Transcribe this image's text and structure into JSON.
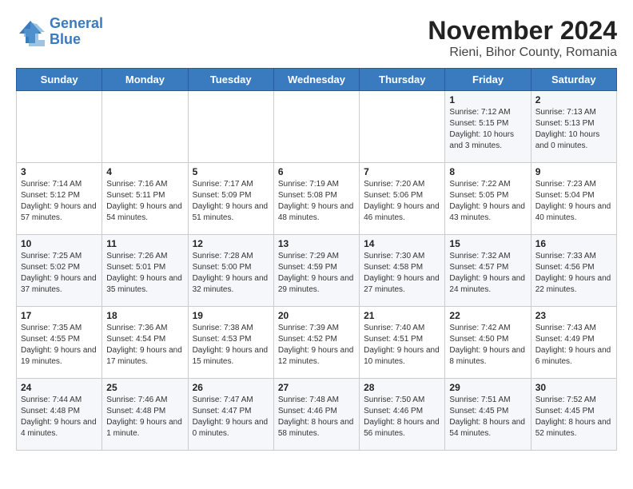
{
  "header": {
    "logo_line1": "General",
    "logo_line2": "Blue",
    "title": "November 2024",
    "subtitle": "Rieni, Bihor County, Romania"
  },
  "weekdays": [
    "Sunday",
    "Monday",
    "Tuesday",
    "Wednesday",
    "Thursday",
    "Friday",
    "Saturday"
  ],
  "weeks": [
    [
      {
        "day": "",
        "info": ""
      },
      {
        "day": "",
        "info": ""
      },
      {
        "day": "",
        "info": ""
      },
      {
        "day": "",
        "info": ""
      },
      {
        "day": "",
        "info": ""
      },
      {
        "day": "1",
        "info": "Sunrise: 7:12 AM\nSunset: 5:15 PM\nDaylight: 10 hours\nand 3 minutes."
      },
      {
        "day": "2",
        "info": "Sunrise: 7:13 AM\nSunset: 5:13 PM\nDaylight: 10 hours\nand 0 minutes."
      }
    ],
    [
      {
        "day": "3",
        "info": "Sunrise: 7:14 AM\nSunset: 5:12 PM\nDaylight: 9 hours\nand 57 minutes."
      },
      {
        "day": "4",
        "info": "Sunrise: 7:16 AM\nSunset: 5:11 PM\nDaylight: 9 hours\nand 54 minutes."
      },
      {
        "day": "5",
        "info": "Sunrise: 7:17 AM\nSunset: 5:09 PM\nDaylight: 9 hours\nand 51 minutes."
      },
      {
        "day": "6",
        "info": "Sunrise: 7:19 AM\nSunset: 5:08 PM\nDaylight: 9 hours\nand 48 minutes."
      },
      {
        "day": "7",
        "info": "Sunrise: 7:20 AM\nSunset: 5:06 PM\nDaylight: 9 hours\nand 46 minutes."
      },
      {
        "day": "8",
        "info": "Sunrise: 7:22 AM\nSunset: 5:05 PM\nDaylight: 9 hours\nand 43 minutes."
      },
      {
        "day": "9",
        "info": "Sunrise: 7:23 AM\nSunset: 5:04 PM\nDaylight: 9 hours\nand 40 minutes."
      }
    ],
    [
      {
        "day": "10",
        "info": "Sunrise: 7:25 AM\nSunset: 5:02 PM\nDaylight: 9 hours\nand 37 minutes."
      },
      {
        "day": "11",
        "info": "Sunrise: 7:26 AM\nSunset: 5:01 PM\nDaylight: 9 hours\nand 35 minutes."
      },
      {
        "day": "12",
        "info": "Sunrise: 7:28 AM\nSunset: 5:00 PM\nDaylight: 9 hours\nand 32 minutes."
      },
      {
        "day": "13",
        "info": "Sunrise: 7:29 AM\nSunset: 4:59 PM\nDaylight: 9 hours\nand 29 minutes."
      },
      {
        "day": "14",
        "info": "Sunrise: 7:30 AM\nSunset: 4:58 PM\nDaylight: 9 hours\nand 27 minutes."
      },
      {
        "day": "15",
        "info": "Sunrise: 7:32 AM\nSunset: 4:57 PM\nDaylight: 9 hours\nand 24 minutes."
      },
      {
        "day": "16",
        "info": "Sunrise: 7:33 AM\nSunset: 4:56 PM\nDaylight: 9 hours\nand 22 minutes."
      }
    ],
    [
      {
        "day": "17",
        "info": "Sunrise: 7:35 AM\nSunset: 4:55 PM\nDaylight: 9 hours\nand 19 minutes."
      },
      {
        "day": "18",
        "info": "Sunrise: 7:36 AM\nSunset: 4:54 PM\nDaylight: 9 hours\nand 17 minutes."
      },
      {
        "day": "19",
        "info": "Sunrise: 7:38 AM\nSunset: 4:53 PM\nDaylight: 9 hours\nand 15 minutes."
      },
      {
        "day": "20",
        "info": "Sunrise: 7:39 AM\nSunset: 4:52 PM\nDaylight: 9 hours\nand 12 minutes."
      },
      {
        "day": "21",
        "info": "Sunrise: 7:40 AM\nSunset: 4:51 PM\nDaylight: 9 hours\nand 10 minutes."
      },
      {
        "day": "22",
        "info": "Sunrise: 7:42 AM\nSunset: 4:50 PM\nDaylight: 9 hours\nand 8 minutes."
      },
      {
        "day": "23",
        "info": "Sunrise: 7:43 AM\nSunset: 4:49 PM\nDaylight: 9 hours\nand 6 minutes."
      }
    ],
    [
      {
        "day": "24",
        "info": "Sunrise: 7:44 AM\nSunset: 4:48 PM\nDaylight: 9 hours\nand 4 minutes."
      },
      {
        "day": "25",
        "info": "Sunrise: 7:46 AM\nSunset: 4:48 PM\nDaylight: 9 hours\nand 1 minute."
      },
      {
        "day": "26",
        "info": "Sunrise: 7:47 AM\nSunset: 4:47 PM\nDaylight: 9 hours\nand 0 minutes."
      },
      {
        "day": "27",
        "info": "Sunrise: 7:48 AM\nSunset: 4:46 PM\nDaylight: 8 hours\nand 58 minutes."
      },
      {
        "day": "28",
        "info": "Sunrise: 7:50 AM\nSunset: 4:46 PM\nDaylight: 8 hours\nand 56 minutes."
      },
      {
        "day": "29",
        "info": "Sunrise: 7:51 AM\nSunset: 4:45 PM\nDaylight: 8 hours\nand 54 minutes."
      },
      {
        "day": "30",
        "info": "Sunrise: 7:52 AM\nSunset: 4:45 PM\nDaylight: 8 hours\nand 52 minutes."
      }
    ]
  ]
}
